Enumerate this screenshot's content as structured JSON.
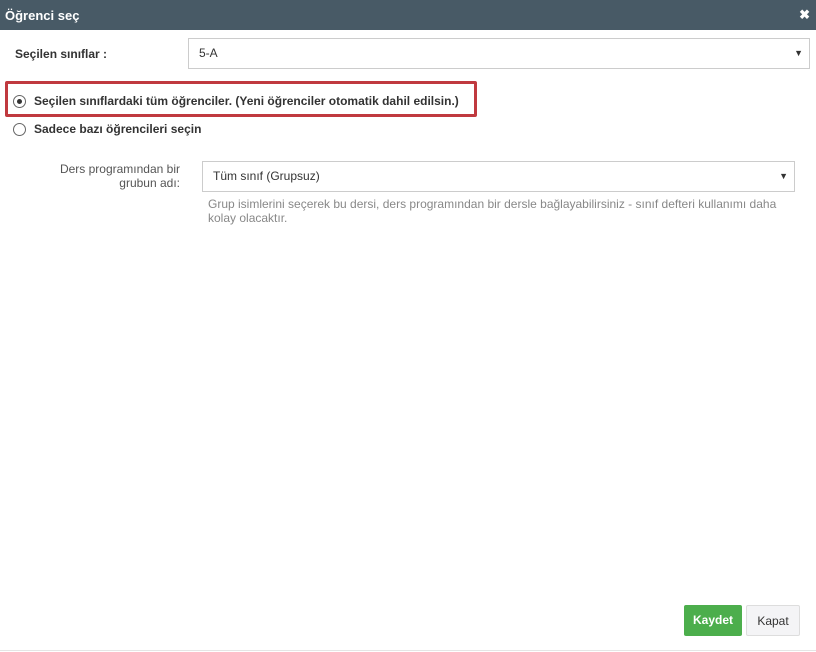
{
  "dialog": {
    "title": "Öğrenci seç",
    "close_icon": "close-icon"
  },
  "classes": {
    "label": "Seçilen sınıflar :",
    "value": "5-A"
  },
  "options": [
    {
      "label": "Seçilen sınıflardaki tüm öğrenciler. (Yeni öğrenciler otomatik dahil edilsin.)",
      "selected": true
    },
    {
      "label": "Sadece bazı öğrencileri seçin",
      "selected": false
    }
  ],
  "group": {
    "label": "Ders programından bir grubun adı:",
    "value": "Tüm sınıf (Grupsuz)",
    "help": "Grup isimlerini seçerek bu dersi, ders programından bir dersle bağlayabilirsiniz - sınıf defteri kullanımı daha kolay olacaktır."
  },
  "buttons": {
    "save": "Kaydet",
    "close": "Kapat"
  }
}
